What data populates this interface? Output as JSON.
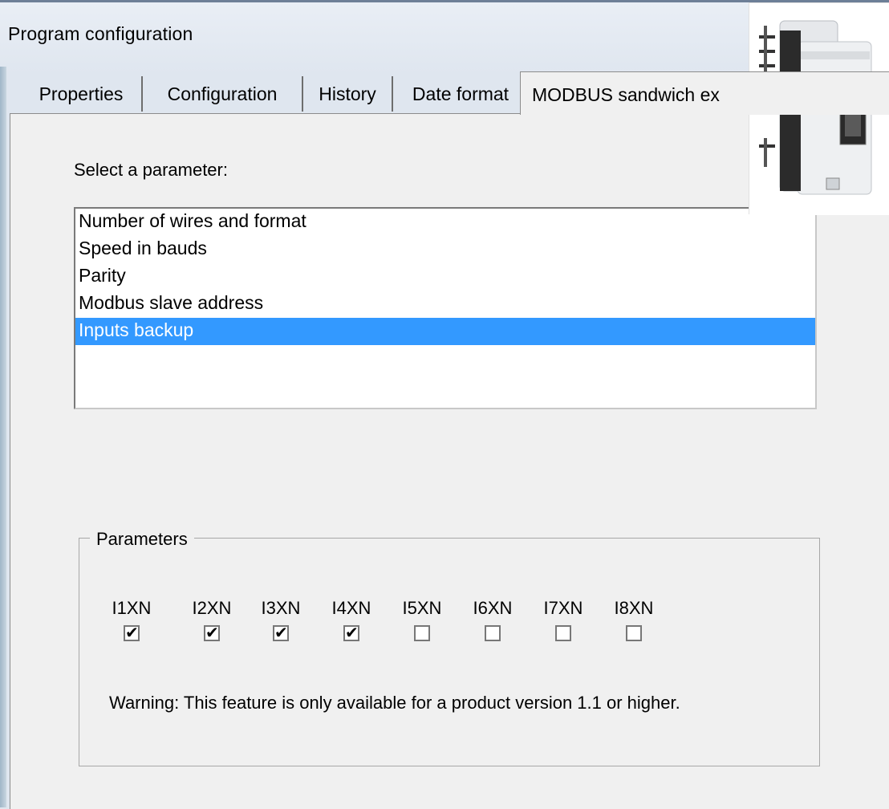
{
  "window": {
    "title": "Program configuration"
  },
  "tabs": [
    {
      "label": "Properties"
    },
    {
      "label": "Configuration"
    },
    {
      "label": "History"
    },
    {
      "label": "Date format"
    },
    {
      "label": "MODBUS sandwich ex"
    }
  ],
  "selector": {
    "label": "Select a parameter:",
    "items": [
      {
        "label": "Number of wires and format",
        "selected": false
      },
      {
        "label": "Speed in bauds",
        "selected": false
      },
      {
        "label": "Parity",
        "selected": false
      },
      {
        "label": "Modbus slave address",
        "selected": false
      },
      {
        "label": "Inputs backup",
        "selected": true
      }
    ]
  },
  "parameters": {
    "title": "Parameters",
    "inputs": [
      {
        "label": "I1XN",
        "checked": true
      },
      {
        "label": "I2XN",
        "checked": true
      },
      {
        "label": "I3XN",
        "checked": true
      },
      {
        "label": "I4XN",
        "checked": true
      },
      {
        "label": "I5XN",
        "checked": false
      },
      {
        "label": "I6XN",
        "checked": false
      },
      {
        "label": "I7XN",
        "checked": false
      },
      {
        "label": "I8XN",
        "checked": false
      }
    ],
    "warning": "Warning: This feature is only available for a product version 1.1 or higher."
  },
  "product_image": {
    "icon": "modbus-module-image"
  },
  "colors": {
    "selection": "#3399ff",
    "panel": "#f0f0f0"
  }
}
